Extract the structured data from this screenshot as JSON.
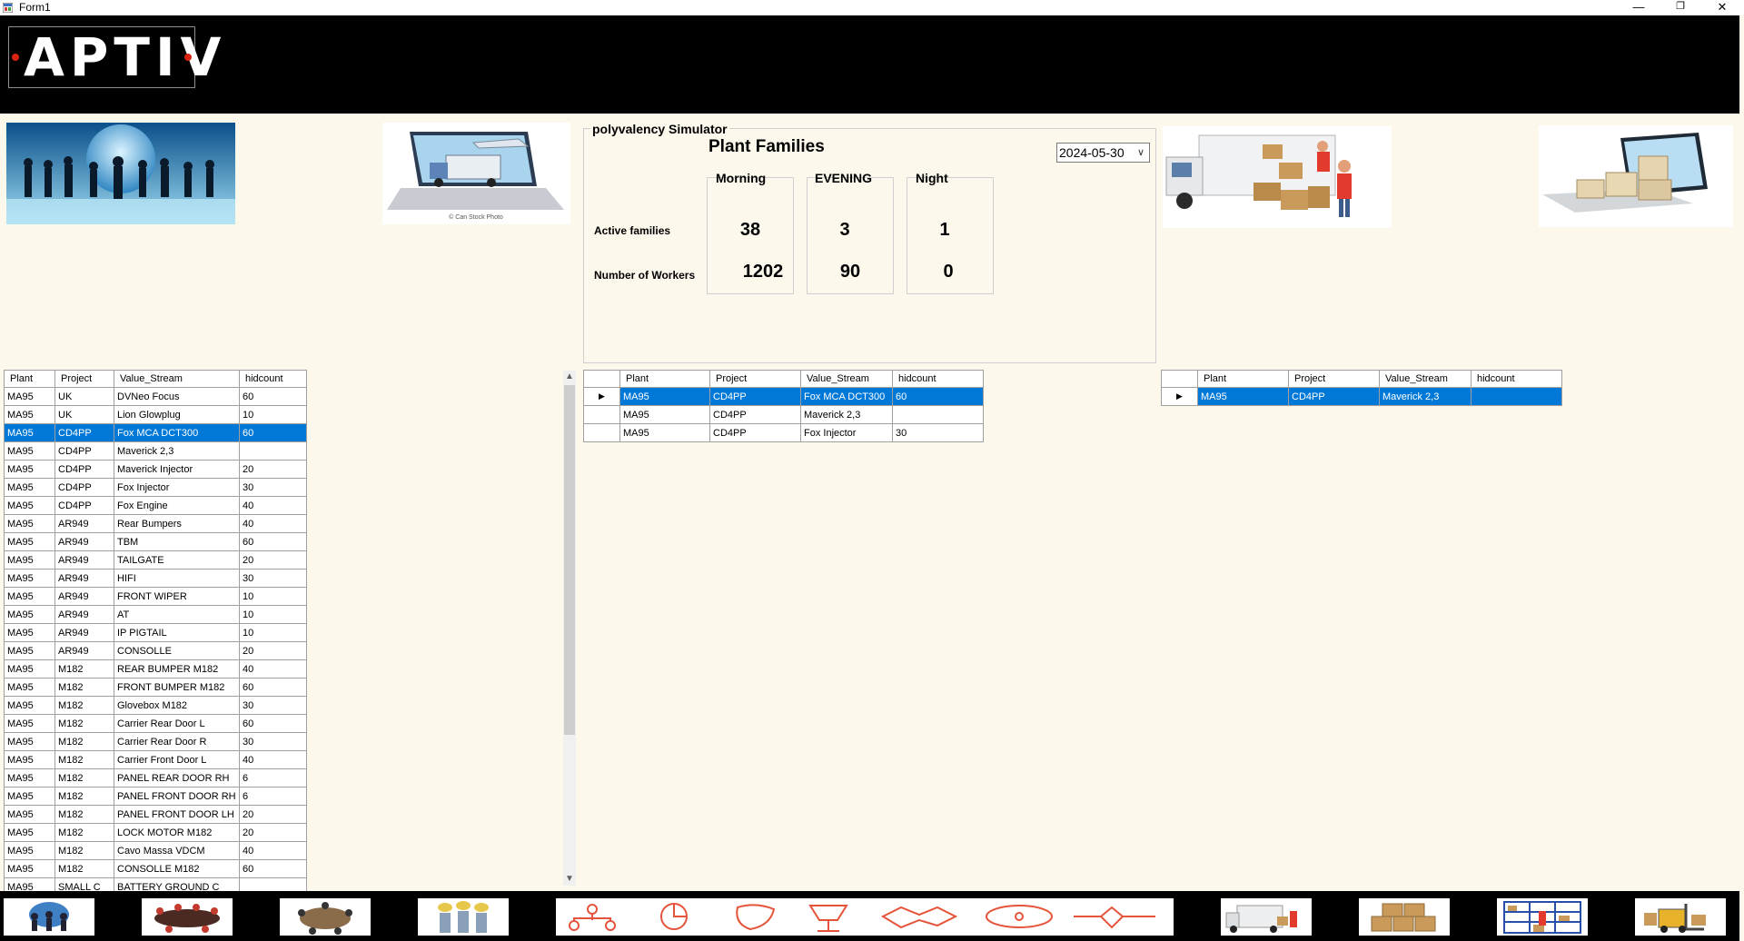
{
  "window": {
    "title": "Form1",
    "minimize": "—",
    "restore": "❐",
    "close": "✕"
  },
  "header": {
    "logo_text": "APTIV"
  },
  "images": [
    {
      "name": "business-people-globe-image"
    },
    {
      "name": "laptop-logistics-image"
    },
    {
      "name": "delivery-truck-image"
    },
    {
      "name": "tablet-boxes-image"
    }
  ],
  "simulator": {
    "group_title": "polyvalency Simulator",
    "title": "Plant Families",
    "date": "2024-05-30",
    "shifts": [
      "Morning",
      "EVENING",
      "Night"
    ],
    "row_labels": [
      "Active families",
      "Number of Workers"
    ],
    "active_families": [
      "38",
      "3",
      "1"
    ],
    "workers": [
      "1202",
      "90",
      "0"
    ]
  },
  "left_table": {
    "columns": [
      "Plant",
      "Project",
      "Value_Stream",
      "hidcount"
    ],
    "selected_index": 2,
    "rows": [
      [
        "MA95",
        "UK",
        "DVNeo Focus",
        "60"
      ],
      [
        "MA95",
        "UK",
        "Lion Glowplug",
        "10"
      ],
      [
        "MA95",
        "CD4PP",
        "Fox MCA DCT300",
        "60"
      ],
      [
        "MA95",
        "CD4PP",
        "Maverick 2,3",
        ""
      ],
      [
        "MA95",
        "CD4PP",
        "Maverick Injector",
        "20"
      ],
      [
        "MA95",
        "CD4PP",
        "Fox Injector",
        "30"
      ],
      [
        "MA95",
        "CD4PP",
        "Fox Engine",
        "40"
      ],
      [
        "MA95",
        "AR949",
        "Rear Bumpers",
        "40"
      ],
      [
        "MA95",
        "AR949",
        "TBM",
        "60"
      ],
      [
        "MA95",
        "AR949",
        "TAILGATE",
        "20"
      ],
      [
        "MA95",
        "AR949",
        "HIFI",
        "30"
      ],
      [
        "MA95",
        "AR949",
        "FRONT WIPER",
        "10"
      ],
      [
        "MA95",
        "AR949",
        "AT",
        "10"
      ],
      [
        "MA95",
        "AR949",
        "IP PIGTAIL",
        "10"
      ],
      [
        "MA95",
        "AR949",
        "CONSOLLE",
        "20"
      ],
      [
        "MA95",
        "M182",
        "REAR BUMPER M182",
        "40"
      ],
      [
        "MA95",
        "M182",
        "FRONT BUMPER M182",
        "60"
      ],
      [
        "MA95",
        "M182",
        "Glovebox M182",
        "30"
      ],
      [
        "MA95",
        "M182",
        "Carrier Rear Door L",
        "60"
      ],
      [
        "MA95",
        "M182",
        "Carrier Rear Door R",
        "30"
      ],
      [
        "MA95",
        "M182",
        "Carrier Front Door L",
        "40"
      ],
      [
        "MA95",
        "M182",
        "PANEL REAR DOOR RH",
        "6"
      ],
      [
        "MA95",
        "M182",
        "PANEL FRONT DOOR RH",
        "6"
      ],
      [
        "MA95",
        "M182",
        "PANEL FRONT DOOR LH",
        "20"
      ],
      [
        "MA95",
        "M182",
        "LOCK MOTOR M182",
        "20"
      ],
      [
        "MA95",
        "M182",
        "Cavo Massa VDCM",
        "40"
      ],
      [
        "MA95",
        "M182",
        "CONSOLLE M182",
        "60"
      ],
      [
        "MA95",
        "SMALL C",
        "BATTERY GROUND C",
        ""
      ]
    ]
  },
  "scrollbar": {
    "up": "▲",
    "down": "▼"
  },
  "middle_table": {
    "columns": [
      "Plant",
      "Project",
      "Value_Stream",
      "hidcount"
    ],
    "row_marker": "▶",
    "rows": [
      [
        "MA95",
        "CD4PP",
        "Fox MCA DCT300",
        "60"
      ],
      [
        "MA95",
        "CD4PP",
        "Maverick 2,3",
        ""
      ],
      [
        "MA95",
        "CD4PP",
        "Fox Injector",
        "30"
      ]
    ]
  },
  "right_table": {
    "columns": [
      "Plant",
      "Project",
      "Value_Stream",
      "hidcount"
    ],
    "row_marker": "▶",
    "rows": [
      [
        "MA95",
        "CD4PP",
        "Maverick 2,3",
        ""
      ]
    ]
  },
  "footer": {
    "buttons": [
      {
        "name": "team-meeting-button"
      },
      {
        "name": "conference-table-button"
      },
      {
        "name": "round-table-button"
      },
      {
        "name": "workers-group-button"
      },
      {
        "name": "process-icons-banner-button"
      },
      {
        "name": "delivery-truck-button"
      },
      {
        "name": "boxes-stack-button"
      },
      {
        "name": "warehouse-shelves-button"
      },
      {
        "name": "forklift-button"
      }
    ]
  }
}
